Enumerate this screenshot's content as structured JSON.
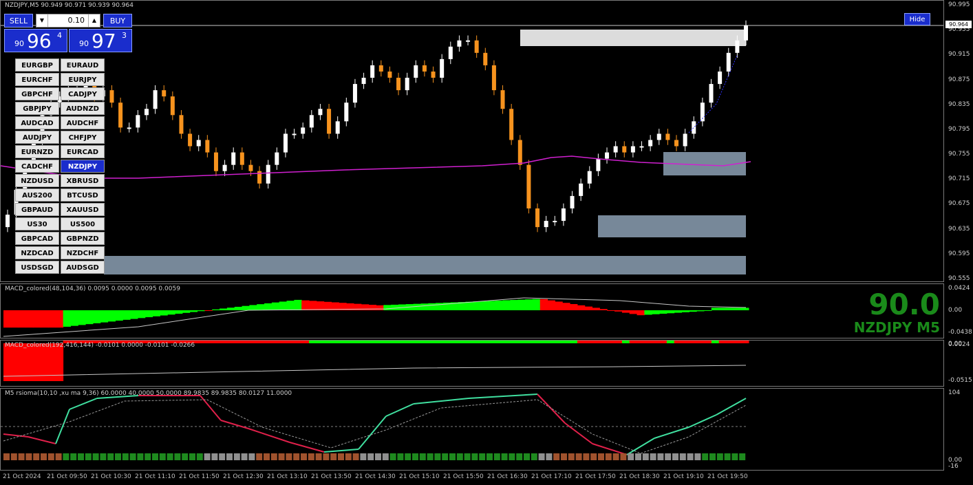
{
  "chart": {
    "header": "NZDJPY,M5  90.949 90.971 90.939 90.964",
    "symbol": "NZDJPY",
    "timeframe": "M5",
    "current_price_label": "90.964",
    "hide_label": "Hide"
  },
  "trade_panel": {
    "sell_label": "SELL",
    "buy_label": "BUY",
    "lot": "0.10",
    "lot_down": "▼",
    "lot_up": "▲",
    "bid_prefix": "90",
    "bid_big": "96",
    "bid_sup": "4",
    "ask_prefix": "90",
    "ask_big": "97",
    "ask_sup": "3"
  },
  "symbols": [
    [
      "EURGBP",
      "EURAUD"
    ],
    [
      "EURCHF",
      "EURJPY"
    ],
    [
      "GBPCHF",
      "CADJPY"
    ],
    [
      "GBPJPY",
      "AUDNZD"
    ],
    [
      "AUDCAD",
      "AUDCHF"
    ],
    [
      "AUDJPY",
      "CHFJPY"
    ],
    [
      "EURNZD",
      "EURCAD"
    ],
    [
      "CADCHF",
      "NZDJPY"
    ],
    [
      "NZDUSD",
      "XBRUSD"
    ],
    [
      "AUS200",
      "BTCUSD"
    ],
    [
      "GBPAUD",
      "XAUUSD"
    ],
    [
      "US30",
      "US500"
    ],
    [
      "GBPCAD",
      "GBPNZD"
    ],
    [
      "NZDCAD",
      "NZDCHF"
    ],
    [
      "USDSGD",
      "AUDSGD"
    ]
  ],
  "active_symbol": "NZDJPY",
  "price_axis": [
    "90.995",
    "90.955",
    "90.915",
    "90.875",
    "90.835",
    "90.795",
    "90.755",
    "90.715",
    "90.675",
    "90.635",
    "90.595",
    "90.555"
  ],
  "macd1": {
    "title": "MACD_colored(48,104,36) 0.0095 0.0000 0.0095 0.0059",
    "axis": [
      "0.0424",
      "0.00",
      "-0.0438"
    ]
  },
  "macd2": {
    "title": "MACD_colored(192,416,144) -0.0101 0.0000 -0.0101 -0.0266",
    "axis": [
      "0.0024",
      "0.00",
      "-0.0515"
    ]
  },
  "rsi": {
    "title": "M5  rsioma(10,10 ,xu ma 9,36) 60.0000 40.0000 50.0000 89.9835 89.9835 80.0127 11.0000",
    "axis": [
      "104",
      "0.00",
      "-16"
    ]
  },
  "big_price": "90.0",
  "big_symbol": "NZDJPY M5",
  "time_axis": [
    "21 Oct 2024",
    "21 Oct 09:50",
    "21 Oct 10:30",
    "21 Oct 11:10",
    "21 Oct 11:50",
    "21 Oct 12:30",
    "21 Oct 13:10",
    "21 Oct 13:50",
    "21 Oct 14:30",
    "21 Oct 15:10",
    "21 Oct 15:50",
    "21 Oct 16:30",
    "21 Oct 17:10",
    "21 Oct 17:50",
    "21 Oct 18:30",
    "21 Oct 19:10",
    "21 Oct 19:50"
  ],
  "colors": {
    "bull": "#ffffff",
    "bear": "#f7931e",
    "ma": "#d020d0",
    "zone_light": "#dcdcdc",
    "zone_gray": "#778899",
    "macd_up": "#00ff00",
    "macd_down": "#ff0000",
    "rsi_up": "#40e0a0",
    "rsi_down": "#e0204a"
  },
  "chart_data": {
    "type": "candlestick",
    "close_series_approx": [
      90.66,
      90.7,
      90.74,
      90.78,
      90.82,
      90.84,
      90.85,
      90.86,
      90.86,
      90.87,
      90.85,
      90.86,
      90.84,
      90.8,
      90.8,
      90.82,
      90.83,
      90.86,
      90.85,
      90.82,
      90.79,
      90.77,
      90.78,
      90.76,
      90.73,
      90.74,
      90.76,
      90.74,
      90.73,
      90.71,
      90.74,
      90.76,
      90.79,
      90.79,
      90.8,
      90.82,
      90.83,
      90.79,
      90.81,
      90.84,
      90.87,
      90.88,
      90.9,
      90.89,
      90.88,
      90.86,
      90.88,
      90.9,
      90.89,
      90.88,
      90.91,
      90.93,
      90.94,
      90.94,
      90.92,
      90.9,
      90.86,
      90.83,
      90.78,
      90.74,
      90.67,
      90.64,
      90.65,
      90.65,
      90.67,
      90.69,
      90.71,
      90.73,
      90.75,
      90.76,
      90.77,
      90.76,
      90.77,
      90.77,
      90.78,
      90.79,
      90.78,
      90.77,
      90.79,
      90.81,
      90.84,
      90.87,
      90.89,
      90.92,
      90.94,
      90.964
    ],
    "ylim": [
      90.555,
      90.995
    ]
  }
}
